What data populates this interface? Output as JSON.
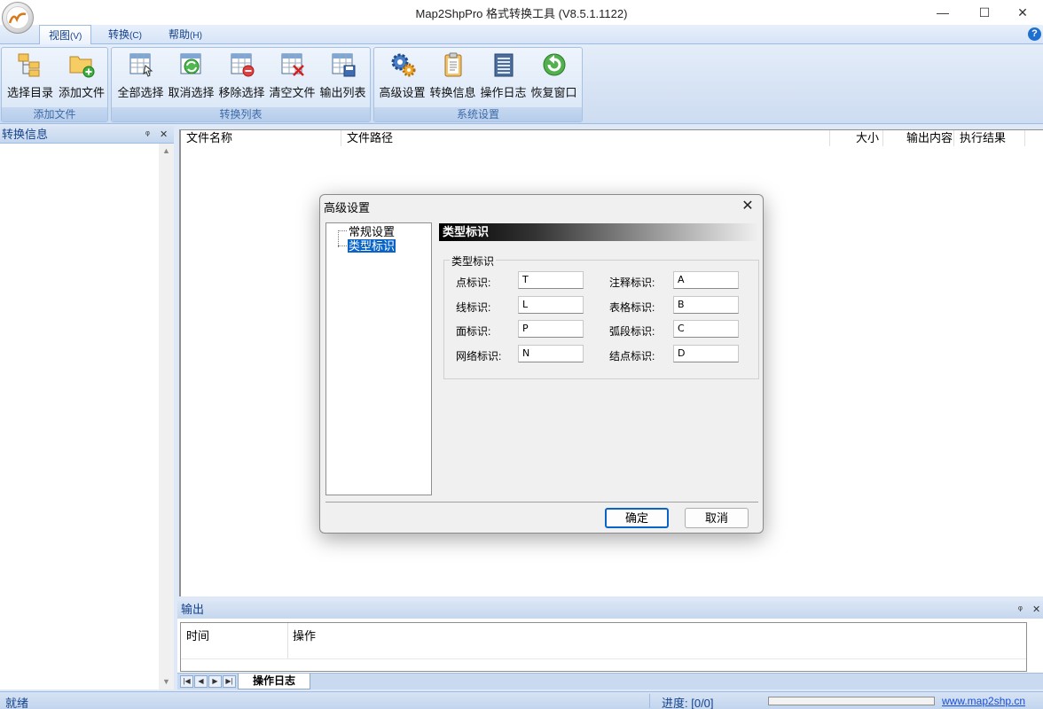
{
  "window": {
    "title": "Map2ShpPro 格式转换工具 (V8.5.1.1122)",
    "minimize": "—",
    "maximize": "☐",
    "close": "✕"
  },
  "menu_tabs": [
    {
      "label": "视图",
      "key": "(V)",
      "active": true
    },
    {
      "label": "转换",
      "key": "(C)",
      "active": false
    },
    {
      "label": "帮助",
      "key": "(H)",
      "active": false
    }
  ],
  "help_icon": "?",
  "ribbon": {
    "groups": [
      {
        "label": "添加文件",
        "buttons": [
          {
            "label": "选择目录",
            "icon": "folder-tree-icon"
          },
          {
            "label": "添加文件",
            "icon": "folder-add-icon"
          }
        ]
      },
      {
        "label": "转换列表",
        "buttons": [
          {
            "label": "全部选择",
            "icon": "table-select-all-icon"
          },
          {
            "label": "取消选择",
            "icon": "table-refresh-icon"
          },
          {
            "label": "移除选择",
            "icon": "table-remove-icon"
          },
          {
            "label": "清空文件",
            "icon": "table-clear-icon"
          },
          {
            "label": "输出列表",
            "icon": "table-save-icon"
          }
        ]
      },
      {
        "label": "系统设置",
        "buttons": [
          {
            "label": "高级设置",
            "icon": "gears-icon"
          },
          {
            "label": "转换信息",
            "icon": "clipboard-icon"
          },
          {
            "label": "操作日志",
            "icon": "log-list-icon"
          },
          {
            "label": "恢复窗口",
            "icon": "restore-icon"
          }
        ]
      }
    ]
  },
  "left_panel": {
    "title": "转换信息",
    "pin": "ᵠ",
    "close": "✕"
  },
  "file_list": {
    "columns": [
      "文件名称",
      "文件路径",
      "大小",
      "输出内容",
      "执行结果"
    ]
  },
  "output_panel": {
    "title": "输出",
    "pin": "ᵠ",
    "close": "✕",
    "columns": [
      "时间",
      "操作"
    ],
    "tab": "操作日志",
    "nav": [
      "|◀",
      "◀",
      "▶",
      "▶|"
    ]
  },
  "status": {
    "ready": "就绪",
    "progress": "进度: [0/0]",
    "progress_value": 0,
    "link": "www.map2shp.cn"
  },
  "dialog": {
    "title": "高级设置",
    "close": "✕",
    "tree": [
      {
        "label": "常规设置",
        "selected": false
      },
      {
        "label": "类型标识",
        "selected": true
      }
    ],
    "section_title": "类型标识",
    "group_label": "类型标识",
    "fields_left": [
      {
        "label": "点标识:",
        "value": "T"
      },
      {
        "label": "线标识:",
        "value": "L"
      },
      {
        "label": "面标识:",
        "value": "P"
      },
      {
        "label": "网络标识:",
        "value": "N"
      }
    ],
    "fields_right": [
      {
        "label": "注释标识:",
        "value": "A"
      },
      {
        "label": "表格标识:",
        "value": "B"
      },
      {
        "label": "弧段标识:",
        "value": "C"
      },
      {
        "label": "结点标识:",
        "value": "D"
      }
    ],
    "ok": "确定",
    "cancel": "取消"
  }
}
